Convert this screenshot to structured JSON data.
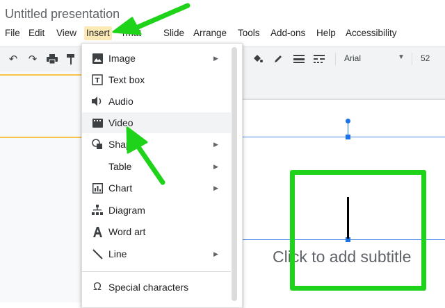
{
  "document": {
    "title": "Untitled presentation"
  },
  "menubar": {
    "items": [
      "File",
      "Edit",
      "View",
      "Insert",
      "Format",
      "Slide",
      "Arrange",
      "Tools",
      "Add-ons",
      "Help",
      "Accessibility"
    ],
    "visible_format_label": "rmat"
  },
  "toolbar": {
    "font_name": "Arial",
    "font_size": "52"
  },
  "insert_menu": {
    "items": [
      {
        "label": "Image",
        "icon": "image-icon",
        "submenu": true
      },
      {
        "label": "Text box",
        "icon": "textbox-icon",
        "submenu": false
      },
      {
        "label": "Audio",
        "icon": "audio-icon",
        "submenu": false
      },
      {
        "label": "Video",
        "icon": "video-icon",
        "submenu": false,
        "highlighted": true
      },
      {
        "label": "Shap",
        "icon": "shape-icon",
        "submenu": true
      },
      {
        "label": "Table",
        "icon": "",
        "submenu": true
      },
      {
        "label": "Chart",
        "icon": "chart-icon",
        "submenu": true
      },
      {
        "label": "Diagram",
        "icon": "diagram-icon",
        "submenu": false
      },
      {
        "label": "Word art",
        "icon": "wordart-icon",
        "submenu": false
      },
      {
        "label": "Line",
        "icon": "line-icon",
        "submenu": true
      },
      {
        "label": "Special characters",
        "icon": "omega-icon",
        "submenu": false
      }
    ]
  },
  "slide": {
    "subtitle_placeholder": "Click to add subtitle"
  },
  "colors": {
    "annotation_green": "#1fd31a",
    "guide_blue": "#4a86e8",
    "menu_hover": "#fde9b6"
  }
}
